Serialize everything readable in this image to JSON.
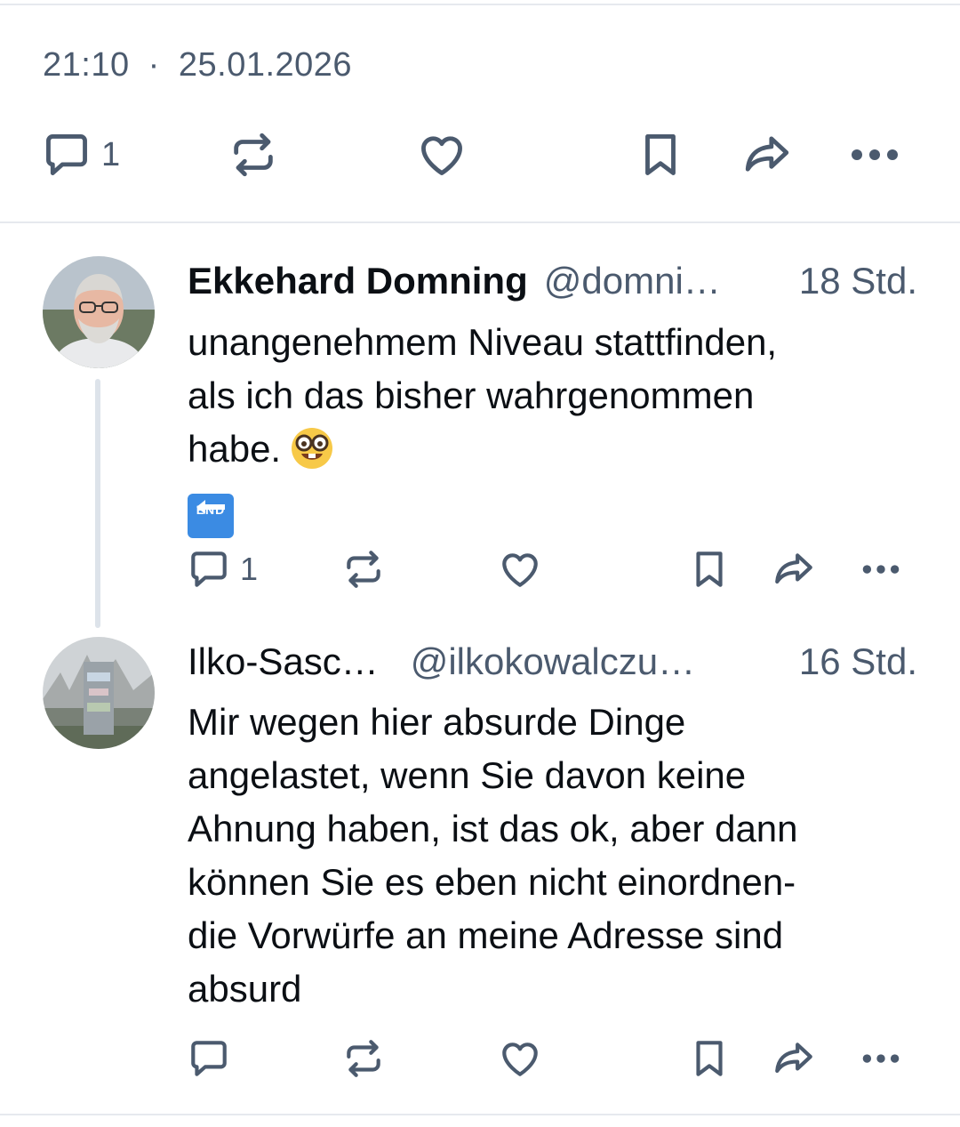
{
  "main_post": {
    "time": "21:10",
    "separator": "·",
    "date": "25.01.2026",
    "reply_count": "1"
  },
  "replies": [
    {
      "name": "Ekkehard Domning",
      "handle": "@domni…",
      "time": "18 Std.",
      "lines": [
        "unangenehmem Niveau stattfinden,",
        "als ich das bisher wahrgenommen",
        "habe."
      ],
      "emoji_name": "nerd-face-icon",
      "end_label": "END",
      "reply_count": "1"
    },
    {
      "name": "Ilko-Sasc…",
      "handle": "@ilkokowalczu…",
      "time": "16 Std.",
      "lines": [
        "Mir wegen hier absurde Dinge",
        "angelastet, wenn Sie davon keine",
        "Ahnung haben, ist das ok, aber dann",
        "können Sie es eben nicht einordnen-",
        "die Vorwürfe an meine Adresse sind",
        "absurd"
      ],
      "reply_count": ""
    }
  ],
  "colors": {
    "icon": "#4b5a6e",
    "text": "#0b0f14",
    "divider": "#e6e9ee",
    "thread_line": "#dde3ea"
  }
}
